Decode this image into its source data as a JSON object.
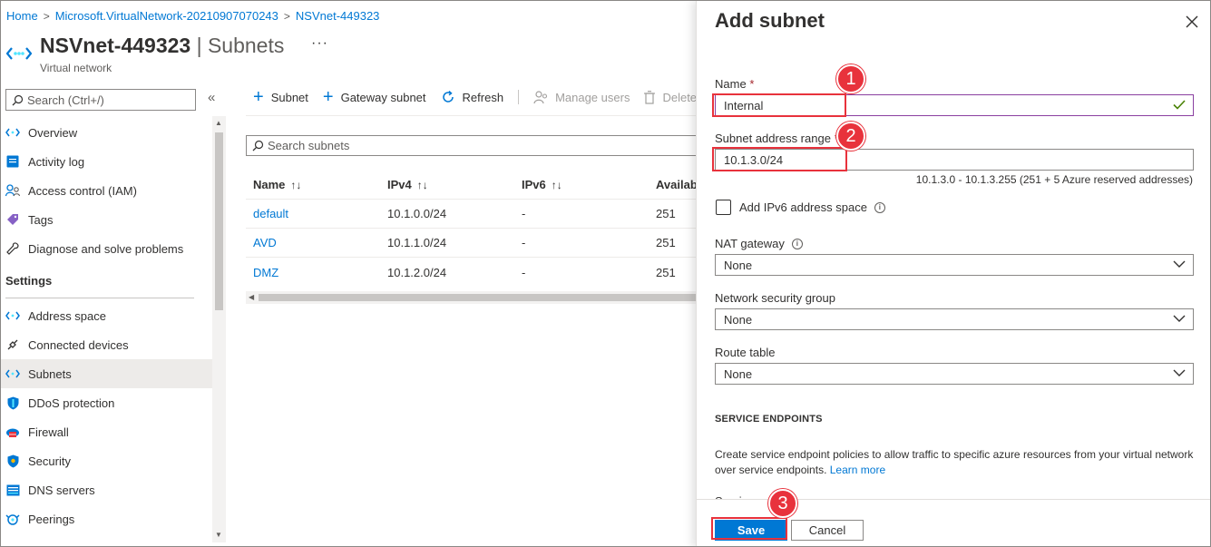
{
  "breadcrumb": {
    "home": "Home",
    "resource_group": "Microsoft.VirtualNetwork-20210907070243",
    "current": "NSVnet-449323"
  },
  "header": {
    "name": "NSVnet-449323",
    "separator": "|",
    "section": "Subnets",
    "more": "···",
    "subtitle": "Virtual network"
  },
  "nav": {
    "search_placeholder": "Search (Ctrl+/)",
    "collapse": "«",
    "items_top": [
      {
        "label": "Overview",
        "icon": "vnet-icon"
      },
      {
        "label": "Activity log",
        "icon": "activity-log-icon"
      },
      {
        "label": "Access control (IAM)",
        "icon": "iam-icon"
      },
      {
        "label": "Tags",
        "icon": "tag-icon"
      },
      {
        "label": "Diagnose and solve problems",
        "icon": "wrench-icon"
      }
    ],
    "settings_header": "Settings",
    "items_settings": [
      {
        "label": "Address space",
        "icon": "vnet-icon"
      },
      {
        "label": "Connected devices",
        "icon": "plug-icon"
      },
      {
        "label": "Subnets",
        "icon": "vnet-icon",
        "active": true
      },
      {
        "label": "DDoS protection",
        "icon": "shield-icon"
      },
      {
        "label": "Firewall",
        "icon": "firewall-icon"
      },
      {
        "label": "Security",
        "icon": "security-icon"
      },
      {
        "label": "DNS servers",
        "icon": "dns-icon"
      },
      {
        "label": "Peerings",
        "icon": "peering-icon"
      }
    ]
  },
  "toolbar": {
    "add_subnet": "Subnet",
    "add_gateway": "Gateway subnet",
    "refresh": "Refresh",
    "manage_users": "Manage users",
    "delete": "Delete"
  },
  "subnet_search_placeholder": "Search subnets",
  "table": {
    "headers": [
      "Name",
      "IPv4",
      "IPv6",
      "Available"
    ],
    "sort_glyph": "↑↓",
    "rows": [
      {
        "name": "default",
        "ipv4": "10.1.0.0/24",
        "ipv6": "-",
        "available": "251"
      },
      {
        "name": "AVD",
        "ipv4": "10.1.1.0/24",
        "ipv6": "-",
        "available": "251"
      },
      {
        "name": "DMZ",
        "ipv4": "10.1.2.0/24",
        "ipv6": "-",
        "available": "251"
      }
    ]
  },
  "panel": {
    "title": "Add subnet",
    "name_label": "Name",
    "required": "*",
    "name_value": "Internal",
    "range_label": "Subnet address range",
    "range_value": "10.1.3.0/24",
    "range_helper": "10.1.3.0 - 10.1.3.255 (251 + 5 Azure reserved addresses)",
    "ipv6_label": "Add IPv6 address space",
    "nat_label": "NAT gateway",
    "nat_value": "None",
    "nsg_label": "Network security group",
    "nsg_value": "None",
    "route_label": "Route table",
    "route_value": "None",
    "service_endpoints_header": "SERVICE ENDPOINTS",
    "service_desc": "Create service endpoint policies to allow traffic to specific azure resources from your virtual network over service endpoints.",
    "learn_more": "Learn more",
    "services_label": "Services",
    "save": "Save",
    "cancel": "Cancel",
    "info_glyph": "i"
  },
  "annotations": {
    "step1": "1",
    "step2": "2",
    "step3": "3"
  },
  "colors": {
    "accent": "#0078d4",
    "annotation": "#e8323c",
    "valid_check": "#498205"
  }
}
